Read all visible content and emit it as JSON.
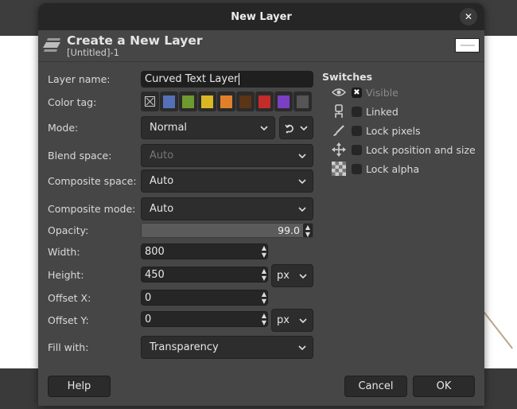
{
  "dialog": {
    "title": "New Layer",
    "close_label": "✕",
    "header_title": "Create a New Layer",
    "header_subtitle": "[Untitled]-1"
  },
  "form": {
    "layer_name": {
      "label": "Layer name:",
      "value": "Curved Text Layer"
    },
    "color_tag": {
      "label": "Color tag:",
      "options": [
        {
          "name": "none",
          "color": "none"
        },
        {
          "name": "blue",
          "color": "#5470b8"
        },
        {
          "name": "green",
          "color": "#6f9a2f"
        },
        {
          "name": "yellow",
          "color": "#dcb724"
        },
        {
          "name": "orange",
          "color": "#e2802a"
        },
        {
          "name": "brown",
          "color": "#5c3416"
        },
        {
          "name": "red",
          "color": "#c42b2b"
        },
        {
          "name": "violet",
          "color": "#7b3fc4"
        },
        {
          "name": "gray",
          "color": "#555555"
        }
      ]
    },
    "mode": {
      "label": "Mode:",
      "value": "Normal"
    },
    "blend_space": {
      "label": "Blend space:",
      "value": "Auto"
    },
    "composite_space": {
      "label": "Composite space:",
      "value": "Auto"
    },
    "composite_mode": {
      "label": "Composite mode:",
      "value": "Auto"
    },
    "opacity": {
      "label": "Opacity:",
      "value": "99.0"
    },
    "width": {
      "label": "Width:",
      "value": "800"
    },
    "height": {
      "label": "Height:",
      "value": "450"
    },
    "size_unit": "px",
    "offset_x": {
      "label": "Offset X:",
      "value": "0"
    },
    "offset_y": {
      "label": "Offset Y:",
      "value": "0"
    },
    "offset_unit": "px",
    "fill_with": {
      "label": "Fill with:",
      "value": "Transparency"
    }
  },
  "switches": {
    "title": "Switches",
    "items": [
      {
        "label": "Visible",
        "checked": true
      },
      {
        "label": "Linked",
        "checked": false
      },
      {
        "label": "Lock pixels",
        "checked": false
      },
      {
        "label": "Lock position and size",
        "checked": false
      },
      {
        "label": "Lock alpha",
        "checked": false
      }
    ]
  },
  "buttons": {
    "help": "Help",
    "cancel": "Cancel",
    "ok": "OK"
  }
}
